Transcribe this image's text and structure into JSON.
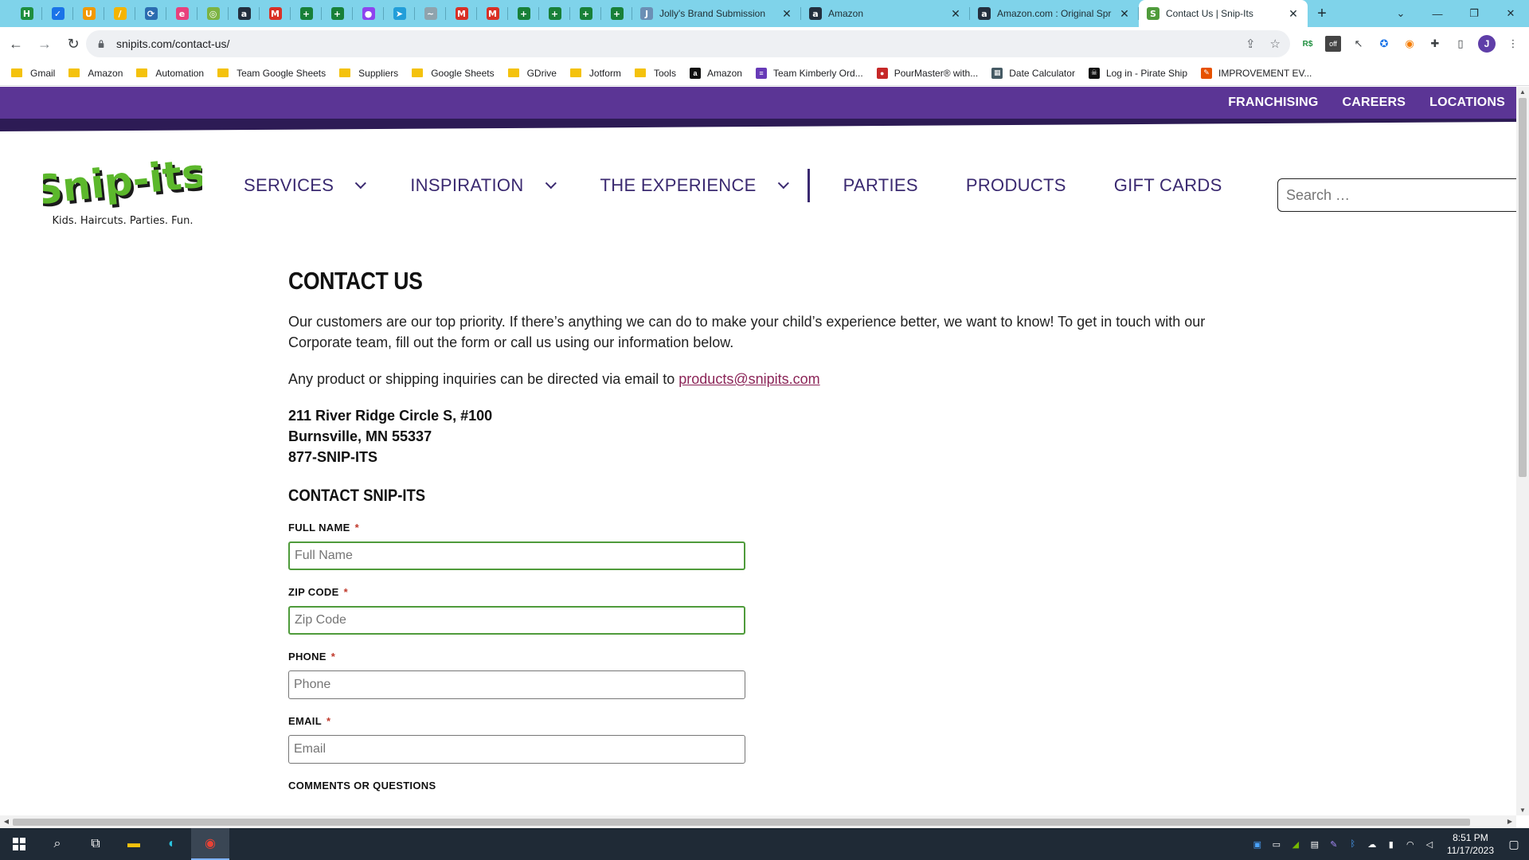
{
  "browser": {
    "pinned_tabs": [
      {
        "icon": "sheets-h-icon",
        "glyph": "H",
        "color": "#1e8e3e"
      },
      {
        "icon": "check-bird-icon",
        "glyph": "✓",
        "color": "#1a73e8"
      },
      {
        "icon": "orange-u-icon",
        "glyph": "U",
        "color": "#f29900"
      },
      {
        "icon": "pen-icon",
        "glyph": "/",
        "color": "#f4b400"
      },
      {
        "icon": "recycle-icon",
        "glyph": "⟳",
        "color": "#2b6cb0"
      },
      {
        "icon": "c-logo-icon",
        "glyph": "e",
        "color": "#e8407c"
      },
      {
        "icon": "leaf-icon",
        "glyph": "◎",
        "color": "#7cb342"
      },
      {
        "icon": "amazon-icon",
        "glyph": "a",
        "color": "#232f3e"
      },
      {
        "icon": "gmail-icon",
        "glyph": "M",
        "color": "#d93025"
      },
      {
        "icon": "sheets-icon",
        "glyph": "+",
        "color": "#188038"
      },
      {
        "icon": "sheets-icon",
        "glyph": "+",
        "color": "#188038"
      },
      {
        "icon": "messenger-icon",
        "glyph": "●",
        "color": "#8e44ef"
      },
      {
        "icon": "telegram-icon",
        "glyph": "➤",
        "color": "#229ed9"
      },
      {
        "icon": "wave-icon",
        "glyph": "~",
        "color": "#8fa3ad"
      },
      {
        "icon": "gmail-icon",
        "glyph": "M",
        "color": "#d93025"
      },
      {
        "icon": "gmail-icon",
        "glyph": "M",
        "color": "#d93025"
      },
      {
        "icon": "sheets-icon",
        "glyph": "+",
        "color": "#188038"
      },
      {
        "icon": "sheets-icon",
        "glyph": "+",
        "color": "#188038"
      },
      {
        "icon": "sheets-icon",
        "glyph": "+",
        "color": "#188038"
      },
      {
        "icon": "sheets-icon",
        "glyph": "+",
        "color": "#188038"
      }
    ],
    "tabs": [
      {
        "label": "Jolly's Brand Submission",
        "glyph": "J",
        "color": "#6b8fb5",
        "active": false
      },
      {
        "label": "Amazon",
        "glyph": "a",
        "color": "#232f3e",
        "active": false
      },
      {
        "label": "Amazon.com : Original Spr",
        "glyph": "a",
        "color": "#232f3e",
        "active": false
      },
      {
        "label": "Contact Us | Snip-Its",
        "glyph": "S",
        "color": "#4f9b3b",
        "active": true
      }
    ],
    "url": "snipits.com/contact-us/",
    "bookmarks": [
      {
        "label": "Gmail",
        "type": "folder"
      },
      {
        "label": "Amazon",
        "type": "folder"
      },
      {
        "label": "Automation",
        "type": "folder"
      },
      {
        "label": "Team Google Sheets",
        "type": "folder"
      },
      {
        "label": "Suppliers",
        "type": "folder"
      },
      {
        "label": "Google Sheets",
        "type": "folder"
      },
      {
        "label": "GDrive",
        "type": "folder"
      },
      {
        "label": "Jotform",
        "type": "folder"
      },
      {
        "label": "Tools",
        "type": "folder"
      },
      {
        "label": "Amazon",
        "type": "icon",
        "glyph": "a",
        "color": "#111111"
      },
      {
        "label": "Team Kimberly Ord...",
        "type": "icon",
        "glyph": "≡",
        "color": "#673ab7"
      },
      {
        "label": "PourMaster® with...",
        "type": "icon",
        "glyph": "●",
        "color": "#c62828"
      },
      {
        "label": "Date Calculator",
        "type": "icon",
        "glyph": "▦",
        "color": "#455a64"
      },
      {
        "label": "Log in - Pirate Ship",
        "type": "icon",
        "glyph": "☠",
        "color": "#111111"
      },
      {
        "label": "IMPROVEMENT EV...",
        "type": "icon",
        "glyph": "✎",
        "color": "#e65100"
      }
    ]
  },
  "site": {
    "topbar": [
      "FRANCHISING",
      "CAREERS",
      "LOCATIONS"
    ],
    "logo": {
      "name": "Snip-its",
      "tagline": "Kids. Haircuts. Parties. Fun."
    },
    "nav": [
      {
        "label": "SERVICES",
        "dropdown": true
      },
      {
        "label": "INSPIRATION",
        "dropdown": true
      },
      {
        "label": "THE EXPERIENCE",
        "dropdown": true
      },
      {
        "label": "PARTIES",
        "dropdown": false
      },
      {
        "label": "PRODUCTS",
        "dropdown": false
      },
      {
        "label": "GIFT CARDS",
        "dropdown": false
      }
    ],
    "search_placeholder": "Search …",
    "colors": {
      "purple": "#5b3595",
      "nav_text": "#3a2970",
      "green": "#4f9b3b",
      "link": "#8b2457"
    }
  },
  "contact": {
    "title": "CONTACT US",
    "intro": "Our customers are our top priority. If there’s anything we can do to make your child’s experience better, we want to know! To get in touch with our Corporate team, fill out the form or call us using our information below.",
    "inquiry_prefix": "Any product or shipping inquiries can be directed via email to ",
    "email_link": "products@snipits.com",
    "address_line1": "211 River Ridge Circle S, #100",
    "address_line2": "Burnsville, MN 55337",
    "phone": "877-SNIP-ITS",
    "form_title": "CONTACT SNIP-ITS",
    "fields": {
      "full_name": {
        "label": "FULL NAME",
        "placeholder": "Full Name",
        "required": "*"
      },
      "zip": {
        "label": "ZIP CODE",
        "placeholder": "Zip Code",
        "required": "*"
      },
      "phone": {
        "label": "PHONE",
        "placeholder": "Phone",
        "required": "*"
      },
      "email": {
        "label": "EMAIL",
        "placeholder": "Email",
        "required": "*"
      },
      "comments": {
        "label": "COMMENTS OR QUESTIONS"
      }
    }
  },
  "taskbar": {
    "time": "8:51 PM",
    "date": "11/17/2023"
  }
}
